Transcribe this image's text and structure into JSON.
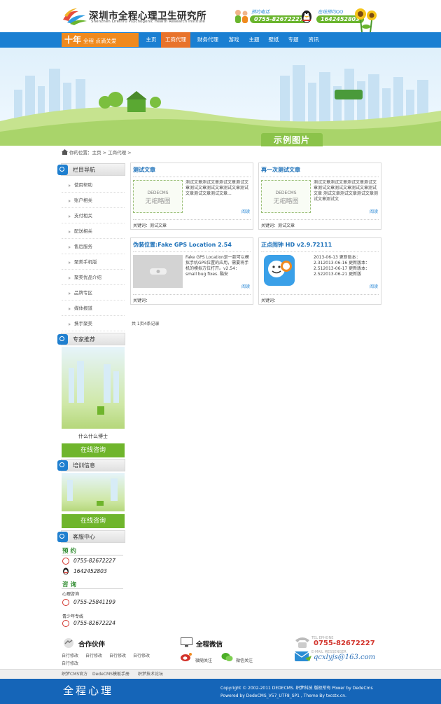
{
  "header": {
    "title": "深圳市全程心理卫生研究所",
    "subtitle": "Shenzhen Lifethru Psychogenic Health Research Institute",
    "phone_label": "预约电话",
    "phone": "0755-82672227",
    "qq_label": "在线预约QQ",
    "qq": "1642452803"
  },
  "nav": {
    "slogan_big": "十年",
    "slogan_small": "全程 点滴关爱",
    "items": [
      "主页",
      "工商代理",
      "财务代理",
      "游戏",
      "主题",
      "壁纸",
      "专题",
      "资讯"
    ],
    "active_index": 1
  },
  "banner": {
    "tag": "示例图片"
  },
  "breadcrumb": {
    "prefix": "你的位置：",
    "home": "主页",
    "sep": " > ",
    "current": "工商代理",
    "tail": " >"
  },
  "sidebar": {
    "nav_title": "栏目导航",
    "nav_items": [
      "使用帮助",
      "账户相关",
      "支付相关",
      "配送相关",
      "售后服务",
      "聚美手机版",
      "聚美优品介绍",
      "品牌专区",
      "媒体报道",
      "携手聚美"
    ],
    "expert_title": "专家推荐",
    "expert_name": "什么什么博士",
    "consult_btn": "在线咨询",
    "training_title": "培训信息",
    "consult_btn2": "在线咨询",
    "service_title": "客服中心",
    "booking_label": "预 约",
    "booking_phone": "0755-82672227",
    "booking_qq": "1642452803",
    "consult_label": "咨 询",
    "consult_sub1": "心理咨询",
    "consult_phone1": "0755-25841199",
    "consult_sub2": "青少年专线",
    "consult_phone2": "0755-82672224"
  },
  "articles": [
    {
      "title": "测试文章",
      "thumb_line1": "DEDECMS",
      "thumb_line2": "无缩略图",
      "desc": "测试文章测试文章测试文章测试文章测试文章测试文章测试文章测试文章测试文章测试文章...",
      "more": "阅读",
      "keywords": "关键词：测试文章"
    },
    {
      "title": "再一次测试文章",
      "thumb_line1": "DEDECMS",
      "thumb_line2": "无缩略图",
      "desc": "测试文章测试文章测试文章测试文章测试文章测试文章测试文章测试文章 测试文章测试文章测试文章测试文章测试文",
      "more": "阅读",
      "keywords": "关键词：测试文章"
    },
    {
      "title": "伪装位置:Fake GPS Location 2.54",
      "desc": "Fake GPS Location是一款可以模拟手机GPS位置的应用，需要将手机的模拟方位打开。v2.54： small bug fixes. 酷安",
      "more": "阅读",
      "keywords": "关键词："
    },
    {
      "title": "正点闹钟 HD v2.9.72111",
      "desc": "2013-06-13 更新版本：2.312013-06-16 更新版本：2.512013-06-17 更新版本：2.522013-06-21 更新版",
      "more": "阅读",
      "keywords": "关键词："
    }
  ],
  "pager": "共 1页4条记录",
  "footer": {
    "partners_title": "合作伙伴",
    "partner_links": [
      "自行修改",
      "自行修改",
      "自行修改",
      "自行修改",
      "自行修改"
    ],
    "wechat_title": "全程微信",
    "weibo_label": "微随关注",
    "weixin_label": "微信关注",
    "phone_small": "TEL EPHONE",
    "phone": "0755-82672227",
    "email_small": "E-MAIL MESSENGER",
    "email": "qcxlyjs@163.com",
    "bottom_links": [
      "织梦CMS官方",
      "DedeCMS模板手册",
      "织梦技术论坛"
    ],
    "logo_text": "全程心理",
    "copyright1": "Copyright © 2002-2011 DEDECMS. 织梦科技 版权所有 Power by DedeCms",
    "copyright2": "Powered by DedeCMS_V57_UTF8_SP1 ,  Theme By txcstx.cn."
  }
}
